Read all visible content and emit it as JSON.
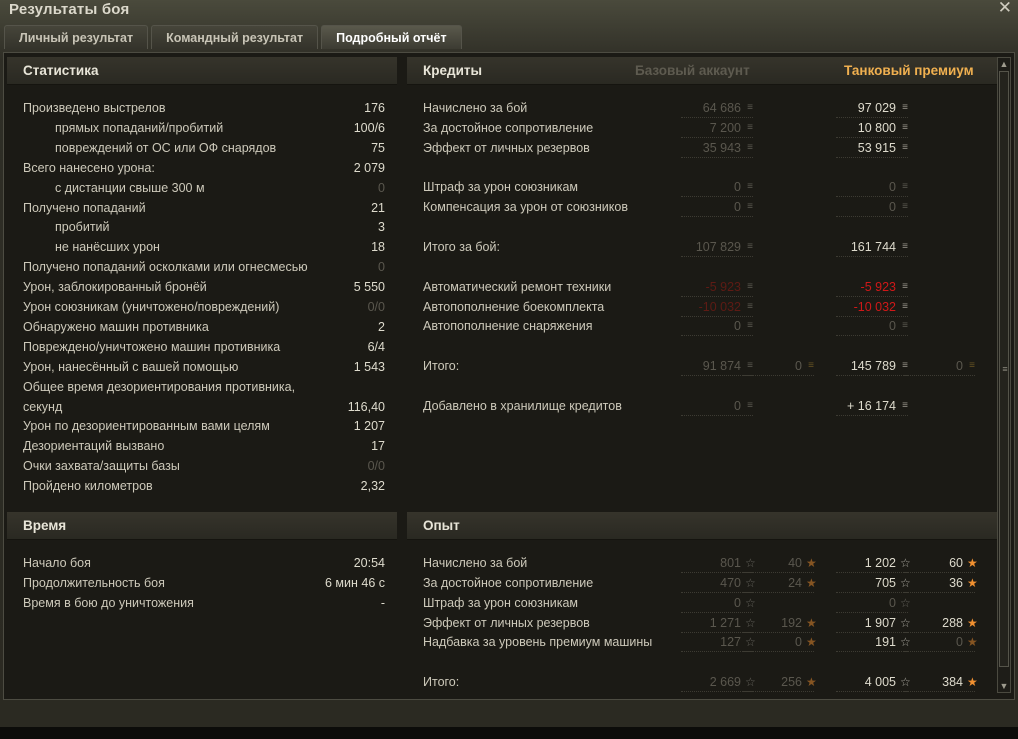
{
  "window": {
    "title": "Результаты боя",
    "close_icon": "close-icon"
  },
  "tabs": [
    {
      "label": "Личный результат",
      "active": false
    },
    {
      "label": "Командный результат",
      "active": false
    },
    {
      "label": "Подробный отчёт",
      "active": true
    }
  ],
  "statistics": {
    "title": "Статистика",
    "rows": [
      {
        "label": "Произведено выстрелов",
        "value": "176"
      },
      {
        "label": "прямых попаданий/пробитий",
        "value": "100/6",
        "indent": true
      },
      {
        "label": "повреждений от ОС или ОФ снарядов",
        "value": "75",
        "indent": true
      },
      {
        "label": "Всего нанесено урона:",
        "value": "2 079"
      },
      {
        "label": "с дистанции свыше 300 м",
        "value": "0",
        "indent": true,
        "dim": true
      },
      {
        "label": "Получено попаданий",
        "value": "21"
      },
      {
        "label": "пробитий",
        "value": "3",
        "indent": true
      },
      {
        "label": "не нанёсших урон",
        "value": "18",
        "indent": true
      },
      {
        "label": "Получено попаданий осколками или огнесмесью",
        "value": "0",
        "dim": true
      },
      {
        "label": "Урон, заблокированный бронёй",
        "value": "5 550"
      },
      {
        "label": "Урон союзникам (уничтожено/повреждений)",
        "value": "0/0",
        "dim": true
      },
      {
        "label": "Обнаружено машин противника",
        "value": "2"
      },
      {
        "label": "Повреждено/уничтожено машин противника",
        "value": "6/4"
      },
      {
        "label": "Урон, нанесённый с вашей помощью",
        "value": "1 543"
      },
      {
        "label": "Общее время дезориентирования противника,",
        "value": ""
      },
      {
        "label": "секунд",
        "value": "116,40"
      },
      {
        "label": "Урон по дезориентированным вами целям",
        "value": "1 207"
      },
      {
        "label": "Дезориентаций вызвано",
        "value": "17"
      },
      {
        "label": "Очки захвата/защиты базы",
        "value": "0/0",
        "dim": true
      },
      {
        "label": "Пройдено километров",
        "value": "2,32"
      }
    ]
  },
  "time": {
    "title": "Время",
    "rows": [
      {
        "label": "Начало боя",
        "value": "20:54"
      },
      {
        "label": "Продолжительность боя",
        "value": "6 мин 46 с"
      },
      {
        "label": "Время в бою до уничтожения",
        "value": "-"
      }
    ]
  },
  "credits": {
    "title": "Кредиты",
    "base_header": "Базовый аккаунт",
    "premium_header": "Танковый премиум",
    "premium_color": "#f0b050",
    "icon": "credits-coin-icon",
    "extra_icon": "gold-coin-icon",
    "rows": [
      {
        "label": "Начислено за бой",
        "base": "64 686",
        "premium": "97 029"
      },
      {
        "label": "За достойное сопротивление",
        "base": "7 200",
        "premium": "10 800"
      },
      {
        "label": "Эффект от личных резервов",
        "base": "35 943",
        "premium": "53 915"
      },
      null,
      {
        "label": "Штраф за урон союзникам",
        "base": "0",
        "premium": "0"
      },
      {
        "label": "Компенсация за урон от союзников",
        "base": "0",
        "premium": "0"
      },
      null,
      {
        "label": "Итого за бой:",
        "base": "107 829",
        "premium": "161 744"
      },
      null,
      {
        "label": "Автоматический ремонт техники",
        "base": "-5 923",
        "premium": "-5 923"
      },
      {
        "label": "Автопополнение боекомплекта",
        "base": "-10 032",
        "premium": "-10 032"
      },
      {
        "label": "Автопополнение снаряжения",
        "base": "0",
        "premium": "0"
      },
      null,
      {
        "label": "Итого:",
        "base": "91 874",
        "base_extra": "0",
        "premium": "145 789",
        "premium_extra": "0"
      },
      null,
      {
        "label": "Добавлено в хранилище кредитов",
        "base": "0",
        "premium": "+ 16 174"
      }
    ]
  },
  "experience": {
    "title": "Опыт",
    "icon": "experience-star-icon",
    "extra_icon": "free-experience-star-icon",
    "rows": [
      {
        "label": "Начислено за бой",
        "base": "801",
        "base_extra": "40",
        "premium": "1 202",
        "premium_extra": "60"
      },
      {
        "label": "За достойное сопротивление",
        "base": "470",
        "base_extra": "24",
        "premium": "705",
        "premium_extra": "36"
      },
      {
        "label": "Штраф за урон союзникам",
        "base": "0",
        "premium": "0"
      },
      {
        "label": "Эффект от личных резервов",
        "base": "1 271",
        "base_extra": "192",
        "premium": "1 907",
        "premium_extra": "288"
      },
      {
        "label": "Надбавка за уровень премиум машины",
        "base": "127",
        "base_extra": "0",
        "premium": "191",
        "premium_extra": "0"
      },
      null,
      {
        "label": "Итого:",
        "base": "2 669",
        "base_extra": "256",
        "premium": "4 005",
        "premium_extra": "384"
      }
    ]
  }
}
